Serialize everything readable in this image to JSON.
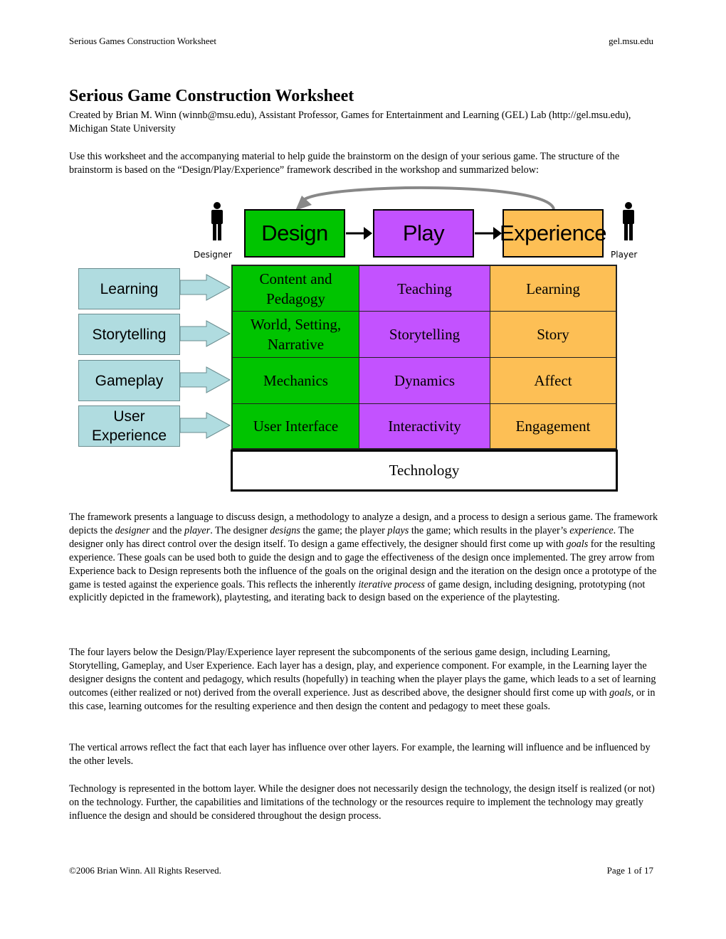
{
  "header": {
    "left": "Serious Games Construction Worksheet",
    "right": "gel.msu.edu"
  },
  "title": "Serious Game Construction Worksheet",
  "byline": "Created by Brian M. Winn (winnb@msu.edu), Assistant Professor, Games for Entertainment and Learning (GEL) Lab (http://gel.msu.edu), Michigan State University",
  "intro": "Use this worksheet and the accompanying material to help guide the brainstorm on the design of your serious game. The structure of the brainstorm is based on the “Design/Play/Experience” framework described in the workshop and summarized below:",
  "diagram": {
    "designer_label": "Designer",
    "player_label": "Player",
    "top": [
      "Design",
      "Play",
      "Experience"
    ],
    "layers": [
      "Learning",
      "Storytelling",
      "Gameplay",
      "User Experience"
    ],
    "rows": [
      [
        "Content and Pedagogy",
        "Teaching",
        "Learning"
      ],
      [
        "World, Setting, Narrative",
        "Storytelling",
        "Story"
      ],
      [
        "Mechanics",
        "Dynamics",
        "Affect"
      ],
      [
        "User Interface",
        "Interactivity",
        "Engagement"
      ]
    ],
    "technology": "Technology",
    "colors": {
      "design": "#00c400",
      "play": "#c352ff",
      "experience": "#fdbf55",
      "layer": "#b0dce0",
      "feedback_arrow": "#888888"
    }
  },
  "paragraphs": [
    [
      {
        "t": "The framework presents a language to discuss design, a methodology to analyze a design, and a process to design a serious game.  The framework depicts the "
      },
      {
        "t": "designer",
        "i": true
      },
      {
        "t": " and the "
      },
      {
        "t": "player",
        "i": true
      },
      {
        "t": ". The designer "
      },
      {
        "t": "designs",
        "i": true
      },
      {
        "t": " the game; the player "
      },
      {
        "t": "plays",
        "i": true
      },
      {
        "t": " the game; which results in the player’s "
      },
      {
        "t": "experience",
        "i": true
      },
      {
        "t": ". The designer only has direct control over the design itself. To design a game effectively, the designer should first come up with "
      },
      {
        "t": "goals",
        "i": true
      },
      {
        "t": " for the resulting experience. These goals can be used both to guide the design and to gage the effectiveness of the design once implemented. The grey arrow from Experience back to Design represents both the influence of the goals on the original design and the iteration on the design once a prototype of the game is tested against the experience goals. This reflects the inherently "
      },
      {
        "t": "iterative process",
        "i": true
      },
      {
        "t": " of game design, including designing, prototyping (not explicitly depicted in the framework), playtesting, and iterating back to design based on the experience of the playtesting."
      }
    ],
    [
      {
        "t": "The four layers below the Design/Play/Experience layer represent the subcomponents of the serious game design, including Learning, Storytelling, Gameplay, and User Experience. Each layer has a design, play, and experience component. For example, in the Learning layer the designer designs the content and pedagogy, which results (hopefully) in teaching when the player plays the game, which leads to a set of learning outcomes (either realized or not) derived from the overall experience. Just as described above, the designer should first come up with "
      },
      {
        "t": "goals",
        "i": true
      },
      {
        "t": ", or in this case, learning outcomes for the resulting experience and then design the content and pedagogy to meet these goals."
      }
    ],
    [
      {
        "t": "The vertical arrows reflect the fact that each layer has influence over other layers. For example, the learning will influence and be influenced by the other levels."
      }
    ],
    [
      {
        "t": "Technology is represented in the bottom layer. While the designer does not necessarily design the technology, the design itself is realized (or not) on the technology. Further, the capabilities and limitations of the technology or the resources require to implement the technology may greatly influence the design and should be considered throughout the design process."
      }
    ]
  ],
  "footer": {
    "left": "©2006 Brian Winn. All Rights Reserved.",
    "right": "Page 1 of 17"
  }
}
